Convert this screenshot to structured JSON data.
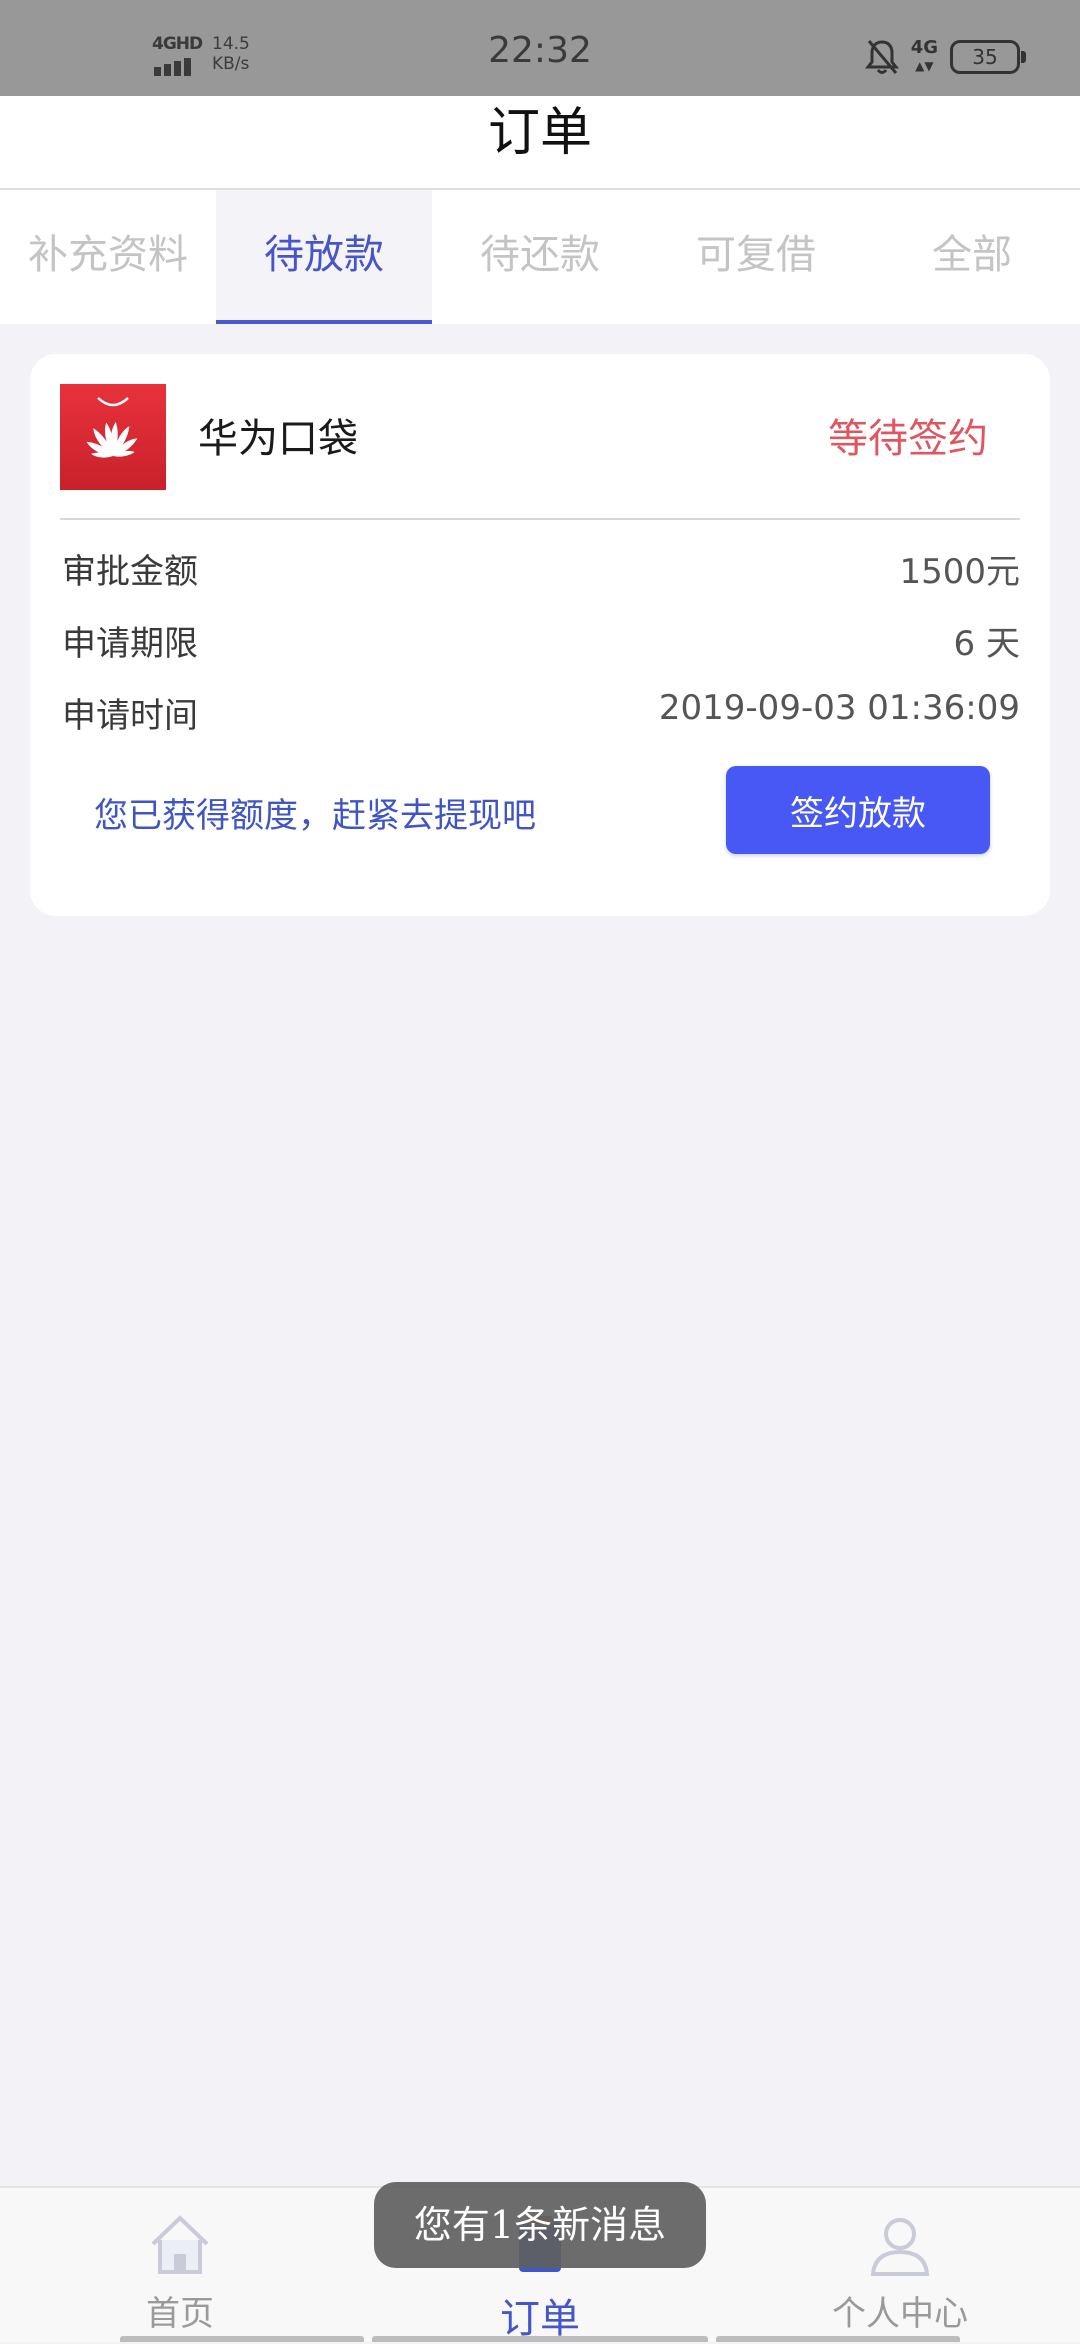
{
  "status_bar": {
    "network": "4GHD",
    "speed_value": "14.5",
    "speed_unit": "KB/s",
    "time": "22:32",
    "right_network": "4G",
    "battery": "35"
  },
  "header": {
    "title": "订单"
  },
  "tabs": [
    {
      "label": "补充资料",
      "active": false
    },
    {
      "label": "待放款",
      "active": true
    },
    {
      "label": "待还款",
      "active": false
    },
    {
      "label": "可复借",
      "active": false
    },
    {
      "label": "全部",
      "active": false
    }
  ],
  "order_card": {
    "app_name": "华为口袋",
    "status": "等待签约",
    "details": [
      {
        "label": "审批金额",
        "value": "1500元"
      },
      {
        "label": "申请期限",
        "value": "6 天"
      },
      {
        "label": "申请时间",
        "value": "2019-09-03 01:36:09"
      }
    ],
    "promo_text": "您已获得额度，赶紧去提现吧",
    "button_label": "签约放款"
  },
  "bottom_nav": [
    {
      "label": "首页",
      "icon": "home-icon",
      "active": false
    },
    {
      "label": "订单",
      "icon": "order-icon",
      "active": true
    },
    {
      "label": "个人中心",
      "icon": "user-icon",
      "active": false
    }
  ],
  "toast": {
    "message": "您有1条新消息"
  },
  "colors": {
    "accent": "#4656c8",
    "button": "#4758f4",
    "status_red": "#e05560",
    "logo_red": "#d8262f"
  }
}
